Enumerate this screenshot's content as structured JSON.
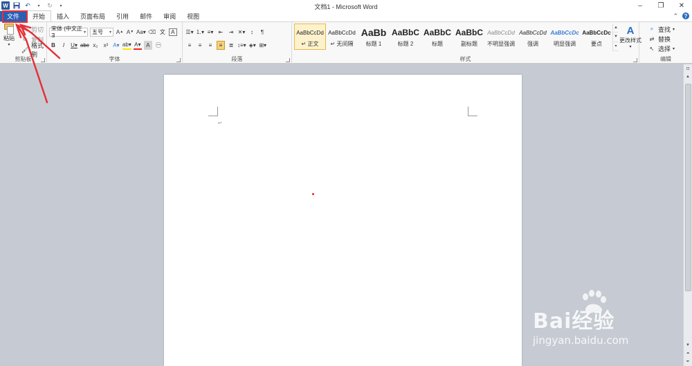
{
  "window": {
    "title": "文档1 - Microsoft Word",
    "controls": [
      "–",
      "❐",
      "✕"
    ]
  },
  "quick_access": {
    "app_icon": "W",
    "save_icon": "save-icon",
    "undo_icon": "undo-icon",
    "redo_icon": "redo-icon",
    "customize_icon": "dropdown-icon"
  },
  "tabs": [
    {
      "label": "文件"
    },
    {
      "label": "开始"
    },
    {
      "label": "插入"
    },
    {
      "label": "页面布局"
    },
    {
      "label": "引用"
    },
    {
      "label": "邮件"
    },
    {
      "label": "审阅"
    },
    {
      "label": "视图"
    }
  ],
  "clipboard": {
    "paste": "粘贴",
    "cut": "剪切",
    "copy": "复制",
    "format_painter": "格式刷",
    "group_label": "剪贴板"
  },
  "font": {
    "name": "宋体 (中文正∃",
    "size": "五号",
    "group_label": "字体",
    "buttons": [
      "A+",
      "A-",
      "Aa",
      "清",
      "拼",
      "A",
      "B",
      "I",
      "U",
      "abc",
      "x₂",
      "x²",
      "A",
      "ab",
      "A",
      "Aa",
      "㊀"
    ]
  },
  "paragraph": {
    "group_label": "段落"
  },
  "styles": {
    "group_label": "样式",
    "items": [
      {
        "preview": "AaBbCcDd",
        "name": "↵ 正文"
      },
      {
        "preview": "AaBbCcDd",
        "name": "↵ 无间隔"
      },
      {
        "preview": "AaBb",
        "name": "标题 1"
      },
      {
        "preview": "AaBbC",
        "name": "标题 2"
      },
      {
        "preview": "AaBbC",
        "name": "标题"
      },
      {
        "preview": "AaBbC",
        "name": "副标题"
      },
      {
        "preview": "AaBbCcDd",
        "name": "不明显强调"
      },
      {
        "preview": "AaBbCcDd",
        "name": "强调"
      },
      {
        "preview": "AaBbCcDc",
        "name": "明显强调"
      },
      {
        "preview": "AaBbCcDc",
        "name": "要点"
      }
    ],
    "change_styles": "更改样式"
  },
  "editing": {
    "find": "查找",
    "replace": "替换",
    "select": "选择",
    "group_label": "编辑"
  },
  "document": {
    "paragraph_mark": "↵"
  },
  "watermark": {
    "brand": "Bai经验",
    "url": "jingyan.baidu.com"
  },
  "colors": {
    "file_tab": "#2b5fb4",
    "annotation": "#e53038",
    "doc_bg": "#c6cbd3"
  }
}
